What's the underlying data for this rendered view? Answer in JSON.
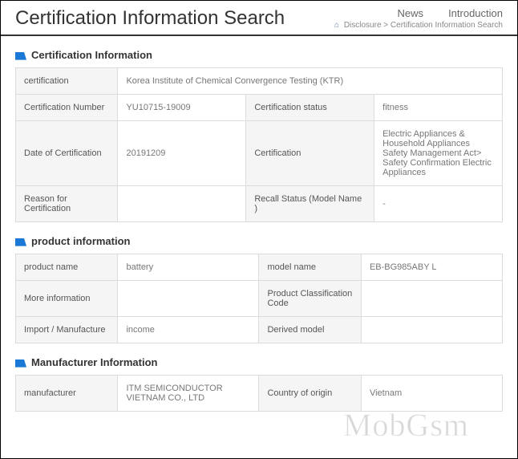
{
  "header": {
    "title": "Certification Information Search",
    "nav": {
      "news": "News",
      "introduction": "Introduction"
    },
    "breadcrumb": {
      "home_icon": "⌂",
      "disclosure": "Disclosure",
      "current": "Certification Information Search",
      "sep": ">"
    }
  },
  "sections": {
    "cert": {
      "title": "Certification Information",
      "rows": {
        "certification_label": "certification",
        "certification_value": "Korea Institute of Chemical Convergence Testing (KTR)",
        "cert_number_label": "Certification Number",
        "cert_number_value": "YU10715-19009",
        "cert_status_label": "Certification status",
        "cert_status_value": "fitness",
        "date_label": "Date of Certification",
        "date_value": "20191209",
        "cert_type_label": "Certification",
        "cert_type_value": "Electric Appliances & Household Appliances Safety Management Act> Safety Confirmation Electric Appliances",
        "reason_label": "Reason for Certification",
        "reason_value": "",
        "recall_label": "Recall Status (Model Name )",
        "recall_value": "-"
      }
    },
    "product": {
      "title": "product information",
      "rows": {
        "product_name_label": "product name",
        "product_name_value": "battery",
        "model_name_label": "model name",
        "model_name_value": "EB-BG985ABY L",
        "more_info_label": "More information",
        "more_info_value": "",
        "class_code_label": "Product Classification Code",
        "class_code_value": "",
        "import_label": "Import / Manufacture",
        "import_value": "income",
        "derived_label": "Derived model",
        "derived_value": ""
      }
    },
    "manufacturer": {
      "title": "Manufacturer Information",
      "rows": {
        "manufacturer_label": "manufacturer",
        "manufacturer_value": "ITM SEMICONDUCTOR VIETNAM CO., LTD",
        "country_label": "Country of origin",
        "country_value": "Vietnam"
      }
    }
  },
  "watermark": "MobGsm"
}
